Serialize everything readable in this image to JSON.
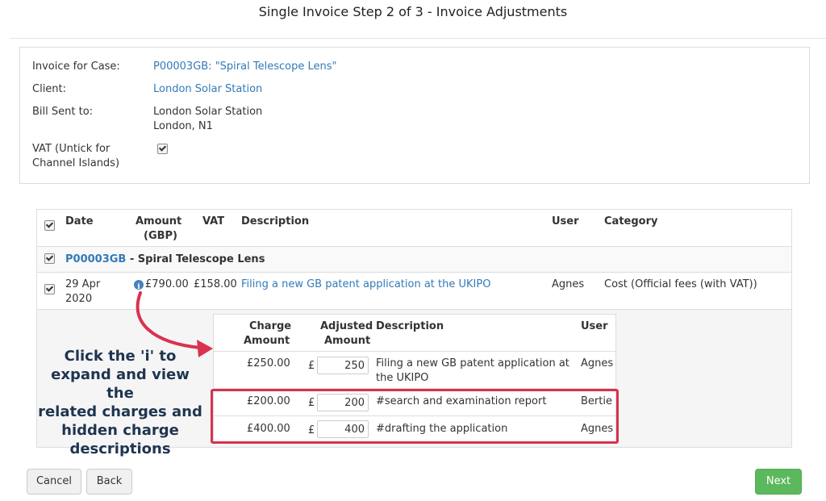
{
  "page": {
    "title": "Single Invoice Step 2 of 3 - Invoice Adjustments"
  },
  "invoice": {
    "case_label": "Invoice for Case:",
    "case_value": "P00003GB: \"Spiral Telescope Lens\"",
    "client_label": "Client:",
    "client_value": "London Solar Station",
    "bill_label": "Bill Sent to:",
    "bill_line1": "London Solar Station",
    "bill_line2": "London, N1",
    "vat_label_line1": "VAT (Untick for",
    "vat_label_line2": "Channel Islands)",
    "vat_checked": true
  },
  "table": {
    "headers": {
      "date": "Date",
      "amount_line1": "Amount",
      "amount_line2": "(GBP)",
      "vat": "VAT",
      "description": "Description",
      "user": "User",
      "category": "Category"
    },
    "case_row": {
      "code": "P00003GB",
      "name": " - Spiral Telescope Lens"
    },
    "item": {
      "date_line1": "29 Apr",
      "date_line2": "2020",
      "amount": "£790.00",
      "vat": "£158.00",
      "description": "Filing a new GB patent application at the UKIPO",
      "user": "Agnes",
      "category": "Cost (Official fees (with VAT))"
    }
  },
  "subtable": {
    "headers": {
      "charge_line1": "Charge",
      "charge_line2": "Amount",
      "adjusted_line1": "Adjusted",
      "adjusted_line2": "Amount",
      "description": "Description",
      "user": "User"
    },
    "currency_symbol": "£",
    "rows": [
      {
        "charge": "£250.00",
        "adjusted": "250",
        "description_line1": "Filing a new GB patent application at",
        "description_line2": "the UKIPO",
        "user": "Agnes"
      },
      {
        "charge": "£200.00",
        "adjusted": "200",
        "description_line1": "#search and examination report",
        "description_line2": "",
        "user": "Bertie"
      },
      {
        "charge": "£400.00",
        "adjusted": "400",
        "description_line1": "#drafting the application",
        "description_line2": "",
        "user": "Agnes"
      }
    ]
  },
  "callout": {
    "line1": "Click the 'i' to",
    "line2": "expand and view the",
    "line3": "related charges and",
    "line4": "hidden charge",
    "line5": "descriptions"
  },
  "buttons": {
    "cancel": "Cancel",
    "back": "Back",
    "next": "Next"
  },
  "colors": {
    "accent_link": "#337ab7",
    "next_button": "#5cb85c",
    "highlight": "#d9324f",
    "callout_text": "#1e3550"
  },
  "icons": {
    "info": "info-icon",
    "checkbox": "checkbox-icon",
    "arrow": "callout-arrow-icon"
  }
}
